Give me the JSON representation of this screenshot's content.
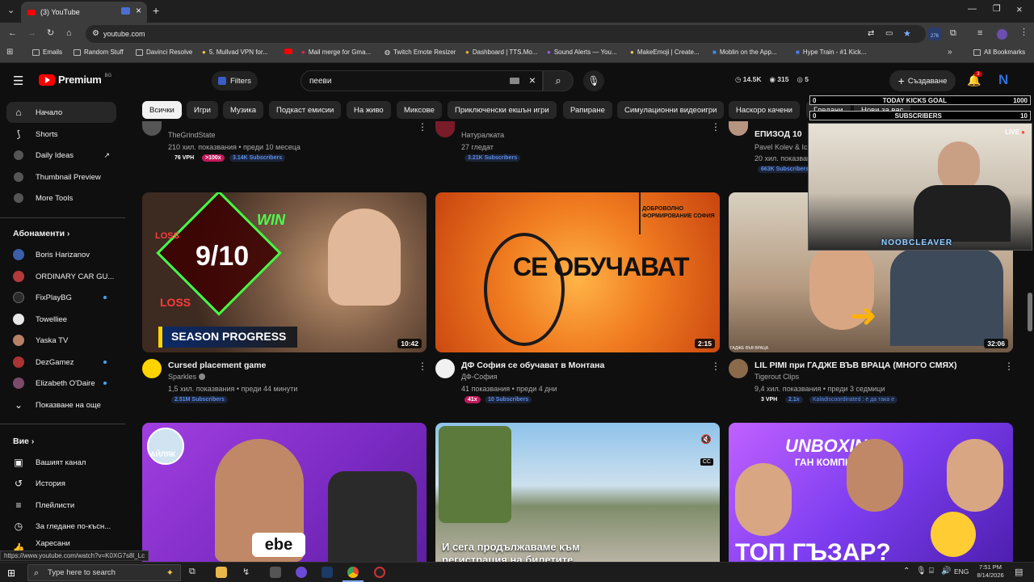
{
  "browser": {
    "tab_title": "(3) YouTube",
    "url": "youtube.com",
    "bookmarks": [
      "Emails",
      "Random Stuff",
      "Davinci Resolve",
      "5. Mullvad VPN for...",
      "Mail merge for Gma...",
      "Twitch Emote Resizer",
      "Dashboard | TTS.Mo...",
      "Sound Alerts — You...",
      "MakeEmoji | Create...",
      "Moblin on the App...",
      "Hype Train - #1 Kick..."
    ],
    "all_bookmarks": "All Bookmarks",
    "ext_badge": "276"
  },
  "header": {
    "logo": "Premium",
    "country": "BG",
    "filters": "Filters",
    "search_value": "пееви",
    "stats": {
      "views": "14.5K",
      "subs": "315",
      "live": "5"
    },
    "create": "Създаване",
    "notif_count": "3",
    "avatar_letter": "N"
  },
  "sidebar": {
    "top": [
      {
        "label": "Начало",
        "icon": "home-icon"
      },
      {
        "label": "Shorts",
        "icon": "shorts-icon"
      },
      {
        "label": "Daily Ideas",
        "icon": "ideas-icon"
      },
      {
        "label": "Thumbnail Preview",
        "icon": "thumbnail-icon"
      },
      {
        "label": "More Tools",
        "icon": "tools-icon"
      }
    ],
    "subs_header": "Абонаменти",
    "subs": [
      {
        "label": "Boris Harizanov",
        "color": "#3b5fa8",
        "dot": false
      },
      {
        "label": "ORDINARY CAR GU...",
        "color": "#b23a3a",
        "dot": false
      },
      {
        "label": "FixPlayBG",
        "color": "#2b2b2b",
        "dot": true
      },
      {
        "label": "Towelliee",
        "color": "#e8e8e8",
        "dot": false
      },
      {
        "label": "Yaska TV",
        "color": "#b98068",
        "dot": false
      },
      {
        "label": "DezGamez",
        "color": "#a33",
        "dot": true
      },
      {
        "label": "Elizabeth O'Daire",
        "color": "#7b4b6b",
        "dot": true
      }
    ],
    "show_more": "Показване на още",
    "you_header": "Вие",
    "you": [
      {
        "label": "Вашият канал",
        "icon": "channel-icon"
      },
      {
        "label": "История",
        "icon": "history-icon"
      },
      {
        "label": "Плейлисти",
        "icon": "playlists-icon"
      },
      {
        "label": "За гледане по-късн...",
        "icon": "watch-later-icon"
      },
      {
        "label": "Харесани видеоклипове",
        "icon": "liked-icon"
      }
    ]
  },
  "chips": [
    "Всички",
    "Игри",
    "Музика",
    "Подкаст емисии",
    "На живо",
    "Миксове",
    "Приключенски екшън игри",
    "Рапиране",
    "Симулационни видеоигри",
    "Наскоро качени",
    "Гледани",
    "Нови за вас"
  ],
  "top_row": [
    {
      "channel": "TheGrindState",
      "meta": "210 хил. показвания • преди 10 месеца",
      "b1": "76 VPH",
      "b2": ">100x",
      "subs": "3.14K Subscribers"
    },
    {
      "channel": "Натуралката",
      "meta": "27 гледат",
      "subs": "3.21K Subscribers"
    },
    {
      "title": "ЕПИЗОД 10",
      "channel": "Pavel Kolev & Ic",
      "meta": "20 хил. показвания",
      "subs": "663K Subscribers"
    }
  ],
  "videos": [
    {
      "title": "Cursed placement game",
      "channel": "Sparkles",
      "meta": "1,5 хил. показвания • преди 44 минути",
      "duration": "10:42",
      "subs": "2.51M Subscribers",
      "thumb_text_a": "9/10",
      "thumb_text_b": "SEASON PROGRESS",
      "thumb_text_c": "WIN",
      "thumb_text_d": "LOSS"
    },
    {
      "title": "ДФ София се обучават в Монтана",
      "channel": "ДФ-София",
      "meta": "41 показвания • преди 4 дни",
      "duration": "2:15",
      "b1": "41x",
      "subs": "10 Subscribers",
      "thumb_text_a": "СЕ ОБУЧАВАТ",
      "thumb_text_b": "ДОБРОВОЛНО ФОРМИРОВАНИЕ СОФИЯ"
    },
    {
      "title": "LIL PIMI при ГАДЖЕ ВЪВ ВРАЦА (МНОГО СМЯХ)",
      "channel": "Tigerout Clips",
      "meta": "9,4 хил. показвания • преди 3 седмици",
      "duration": "32:06",
      "b1": "3 VPH",
      "b2": "2.1x",
      "tagline": "Kaladiscoordinated : е да така е",
      "thumb_text_a": "ГАДЖЕ ВЪВ ВРАЦА"
    }
  ],
  "bottom_row": [
    {
      "thumb_text_a": "АЙЛЯК",
      "thumb_text_b": "ebe"
    },
    {
      "thumb_text_a": "И сега продължаваме към",
      "thumb_text_b": "регистрация на билетите",
      "cc": "CC"
    },
    {
      "thumb_text_a": "UNBOXING",
      "thumb_text_b": "ТОП ГЪЗАР?",
      "thumb_text_c": "ГАН КОМПЮТЪР"
    }
  ],
  "overlay": {
    "row1_left": "0",
    "row1_label": "TODAY KICKS GOAL",
    "row1_right": "1000",
    "row2_left": "0",
    "row2_label": "SUBSCRIBERS",
    "row2_right": "10",
    "live": "LIVE",
    "name": "NOOBCLEAVER"
  },
  "status_url": "https://www.youtube.com/watch?v=K0XG7s8l_Lc",
  "taskbar": {
    "search_placeholder": "Type here to search",
    "lang": "ENG",
    "time": "7:51 PM",
    "date": "8/14/2026"
  }
}
